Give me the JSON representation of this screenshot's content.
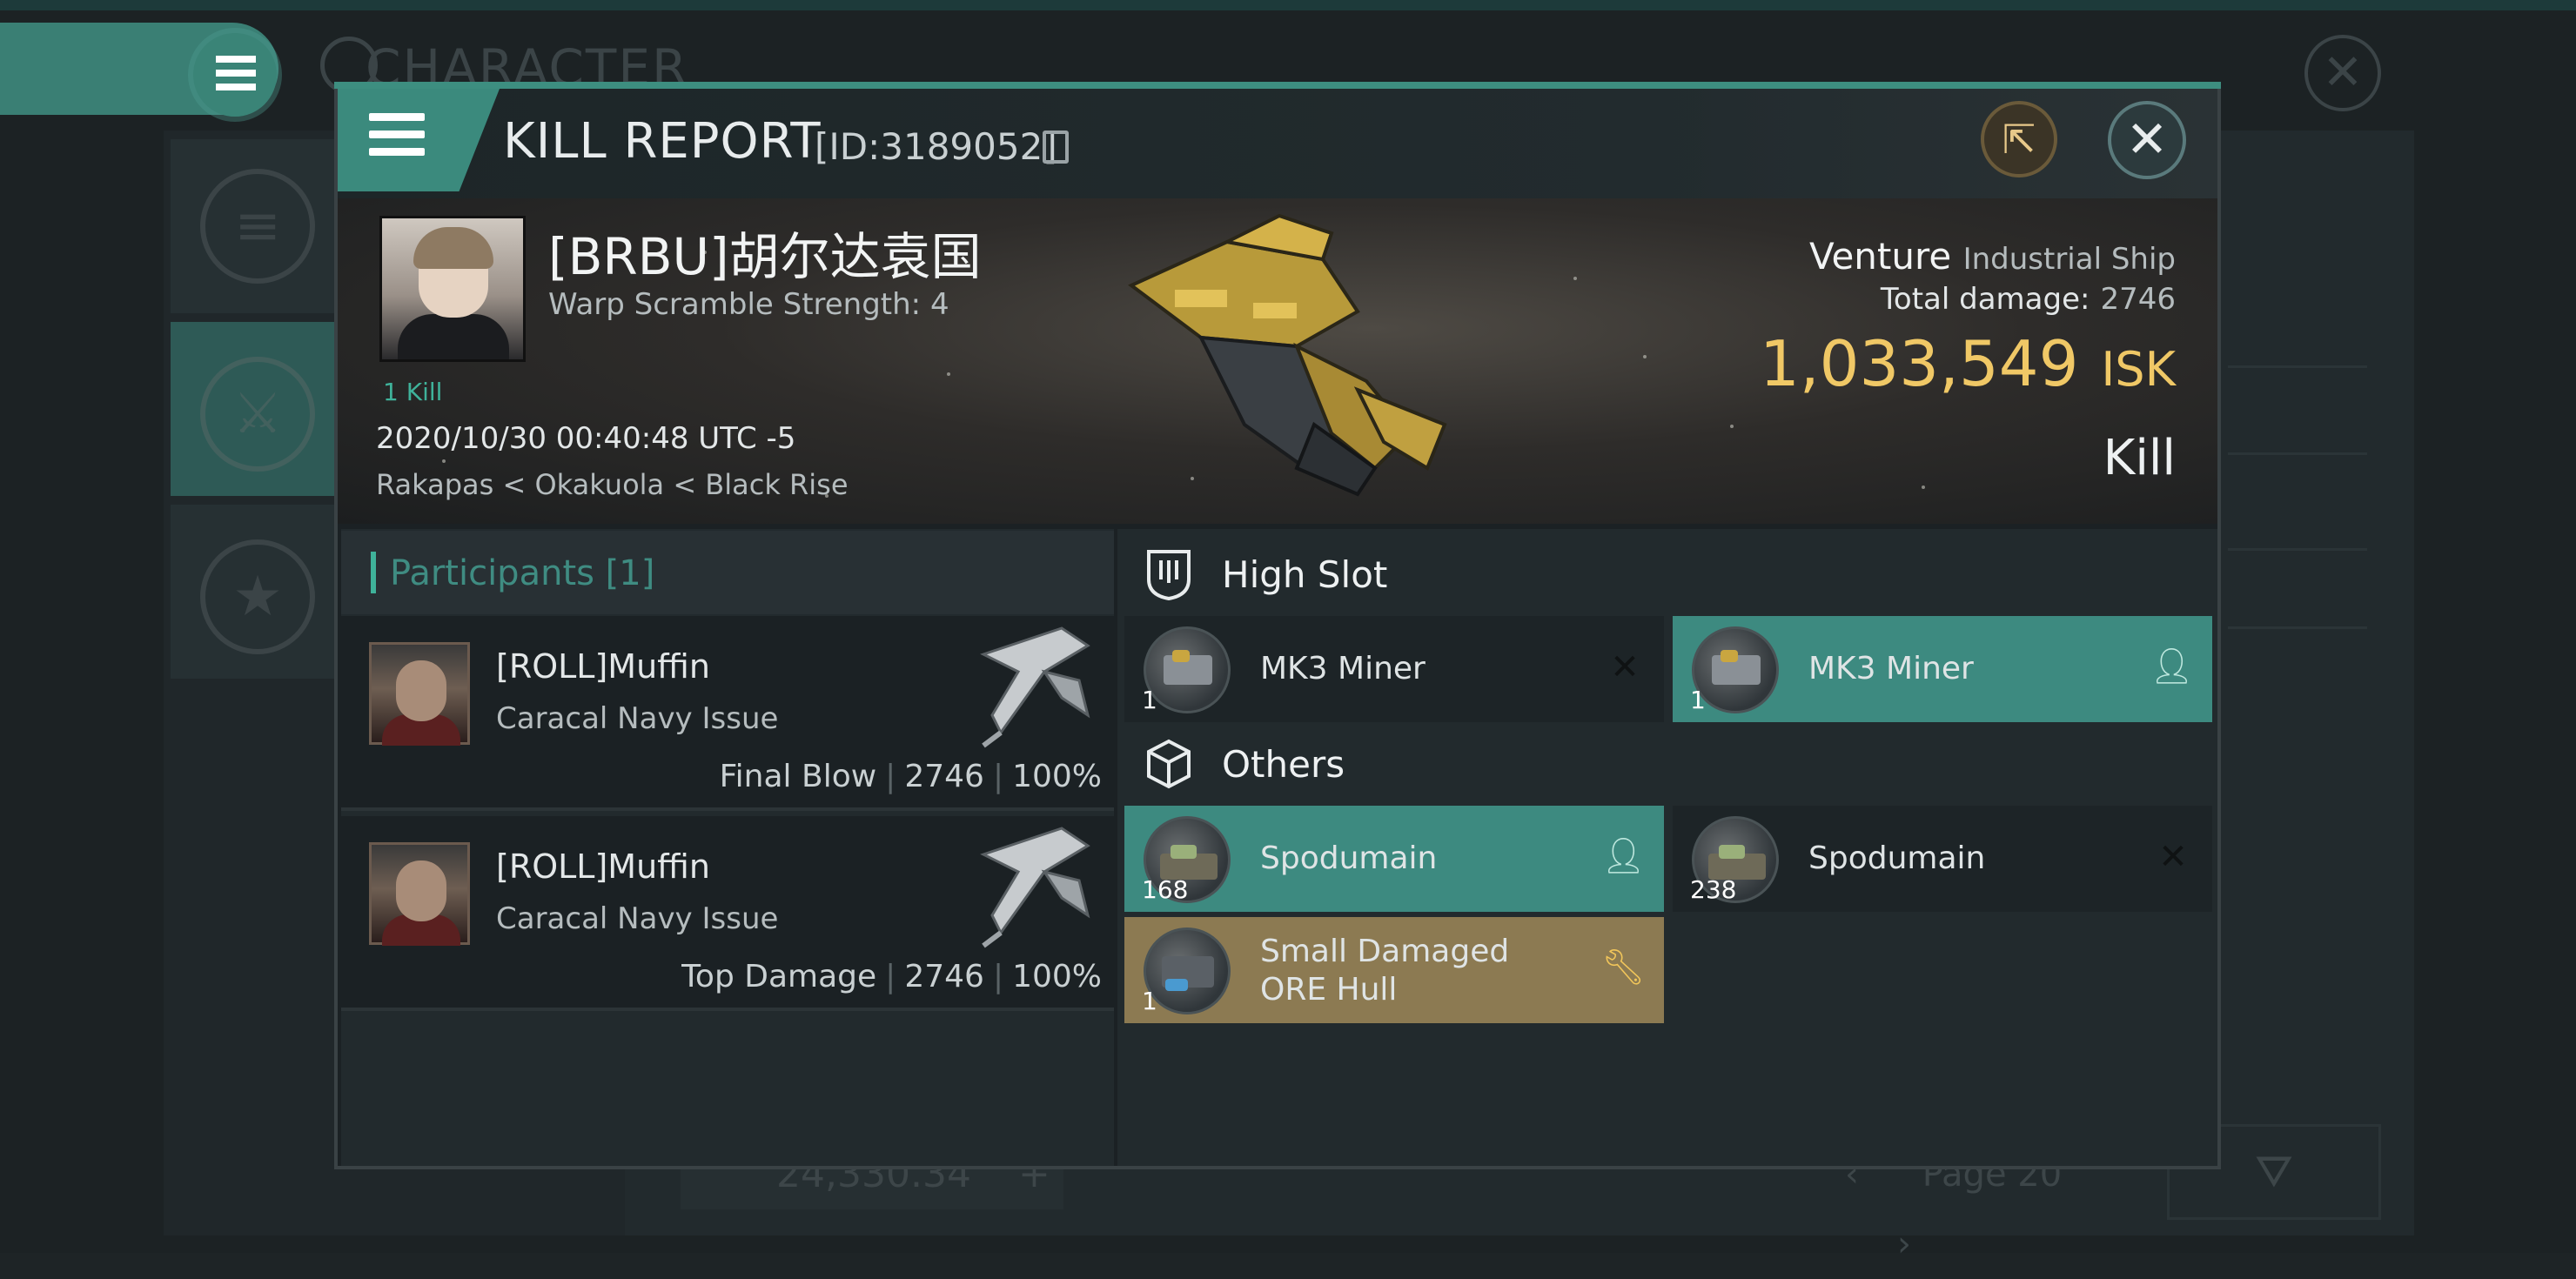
{
  "background": {
    "title": "CHARACTER",
    "bottom_field_value": "24,330.34",
    "bottom_field_sign": "+",
    "page_label": "Page 20"
  },
  "modal": {
    "title": "KILL REPORT",
    "id_label": "[ID:3189052]"
  },
  "victim": {
    "name": "[BRBU]胡尔达袁国",
    "warp_scramble": "Warp Scramble Strength: 4",
    "kill_count": "1 Kill",
    "date": "2020/10/30 00:40:48 UTC -5",
    "location": "Rakapas < Okakuola < Black Rise",
    "ship_name": "Venture",
    "ship_class": "Industrial Ship",
    "total_damage_label": "Total damage:",
    "total_damage_value": "2746",
    "isk_value": "1,033,549",
    "isk_unit": "ISK",
    "result": "Kill"
  },
  "participants": {
    "title": "Participants [1]",
    "rows": [
      {
        "name": "[ROLL]Muffin",
        "ship": "Caracal Navy Issue",
        "role": "Final Blow",
        "damage": "2746",
        "percent": "100%"
      },
      {
        "name": "[ROLL]Muffin",
        "ship": "Caracal Navy Issue",
        "role": "Top Damage",
        "damage": "2746",
        "percent": "100%"
      }
    ]
  },
  "slots": {
    "high_slot": {
      "label": "High Slot",
      "items": [
        {
          "qty": "1",
          "name": "MK3 Miner",
          "status": "destroyed",
          "mark_icon": "x-icon"
        },
        {
          "qty": "1",
          "name": "MK3 Miner",
          "status": "dropped",
          "mark_icon": "person-icon"
        }
      ]
    },
    "others": {
      "label": "Others",
      "items": [
        {
          "qty": "168",
          "name": "Spodumain",
          "status": "dropped",
          "mark_icon": "person-icon"
        },
        {
          "qty": "238",
          "name": "Spodumain",
          "status": "destroyed",
          "mark_icon": "x-icon"
        },
        {
          "qty": "1",
          "name": "Small Damaged ORE Hull",
          "status": "salvage",
          "mark_icon": "wrench-icon"
        }
      ]
    }
  },
  "colors": {
    "accent_teal": "#3d8a80",
    "isk_gold": "#f0c866",
    "salvage_gold": "#8c7a52",
    "kill_count_green": "#3fb29a"
  }
}
